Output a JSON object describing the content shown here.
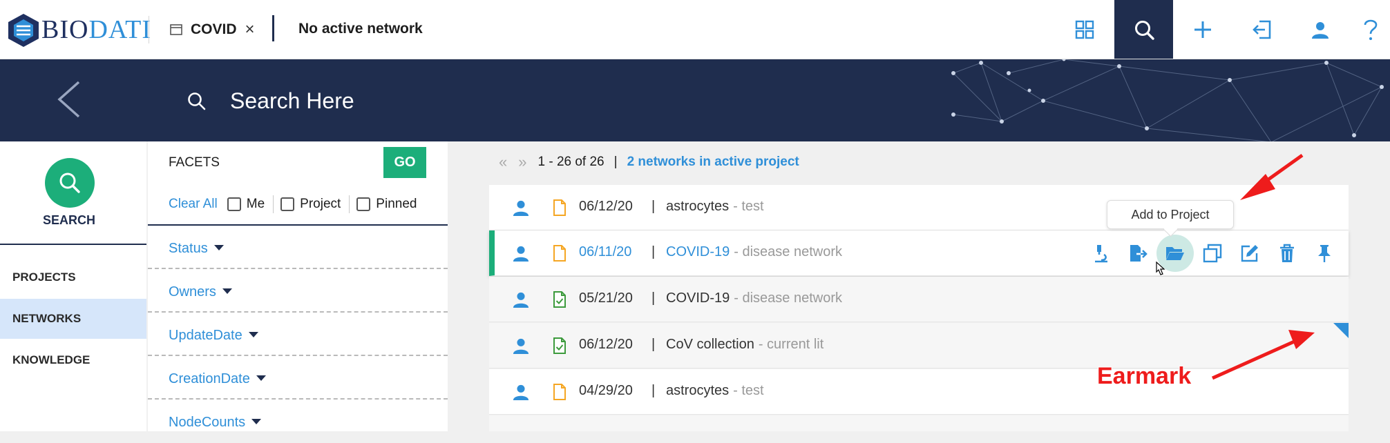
{
  "header": {
    "logo_bio": "BIO",
    "logo_dati": "DATI",
    "project_name": "COVID",
    "active_network": "No active network"
  },
  "search": {
    "placeholder": "Search Here"
  },
  "leftnav": {
    "search_label": "SEARCH",
    "items": [
      {
        "label": "PROJECTS",
        "active": false
      },
      {
        "label": "NETWORKS",
        "active": true
      },
      {
        "label": "KNOWLEDGE",
        "active": false
      }
    ]
  },
  "facets": {
    "title": "FACETS",
    "go_label": "GO",
    "clear_all": "Clear All",
    "checkboxes": [
      {
        "label": "Me",
        "checked": false
      },
      {
        "label": "Project",
        "checked": false
      },
      {
        "label": "Pinned",
        "checked": false
      }
    ],
    "items": [
      "Status",
      "Owners",
      "UpdateDate",
      "CreationDate",
      "NodeCounts"
    ]
  },
  "results": {
    "range_text": "1 - 26 of 26",
    "separator": "|",
    "active_project_text": "2 networks in active project",
    "rows": [
      {
        "date": "06/12/20",
        "name": "astrocytes",
        "desc": "- test",
        "doc_icon": "doc-icon"
      },
      {
        "date": "06/11/20",
        "name": "COVID-19",
        "desc": "- disease network",
        "doc_icon": "doc-icon"
      },
      {
        "date": "05/21/20",
        "name": "COVID-19",
        "desc": "- disease network",
        "doc_icon": "doc-check-icon"
      },
      {
        "date": "06/12/20",
        "name": "CoV collection",
        "desc": "- current lit",
        "doc_icon": "doc-check-icon"
      },
      {
        "date": "04/29/20",
        "name": "astrocytes",
        "desc": "- test",
        "doc_icon": "doc-icon"
      }
    ],
    "row_actions": [
      "microscope-icon",
      "export-icon",
      "folder-open-icon",
      "copy-icon",
      "edit-icon",
      "trash-icon",
      "pin-icon"
    ]
  },
  "tooltip": {
    "text": "Add to Project"
  },
  "annotation": {
    "earmark_label": "Earmark"
  },
  "colors": {
    "navy": "#1f2d4e",
    "accent_blue": "#2f8fd8",
    "green": "#1cae7a",
    "doc_orange": "#f5a623",
    "doc_green": "#3c9a3c",
    "annotation_red": "#ee1c1c",
    "nav_active_bg": "#d6e6fa"
  }
}
